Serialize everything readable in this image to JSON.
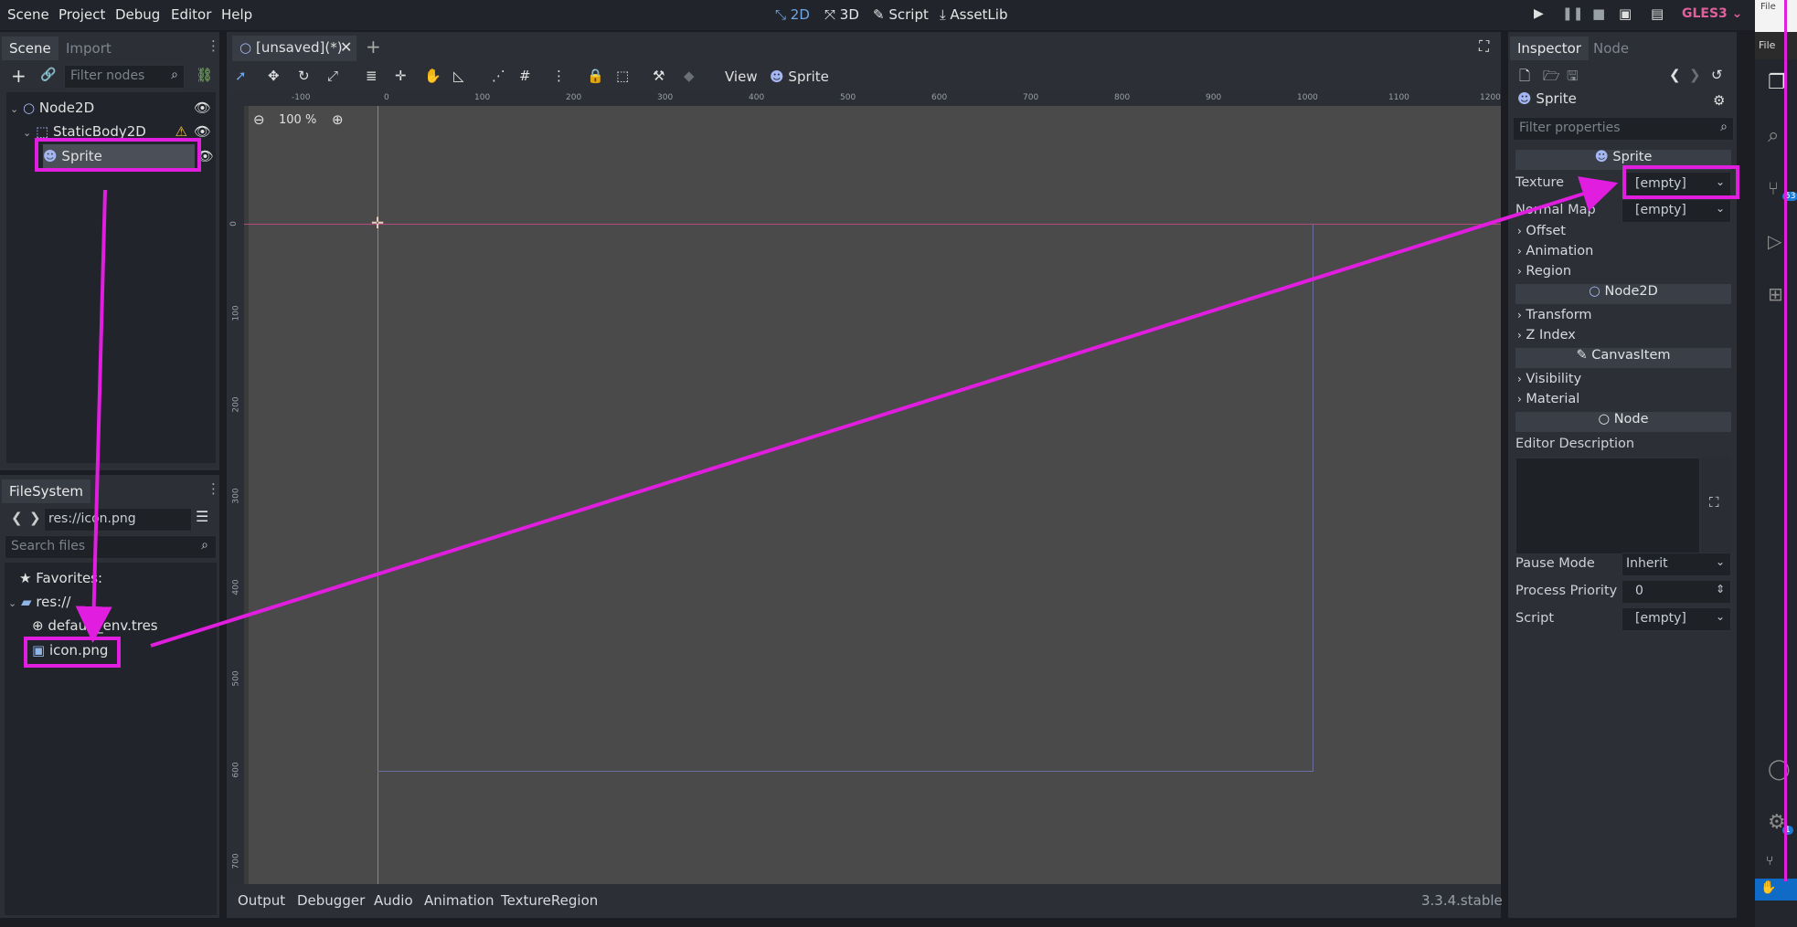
{
  "menubar": {
    "items": [
      "Scene",
      "Project",
      "Debug",
      "Editor",
      "Help"
    ],
    "modes": [
      {
        "icon": "2d-mode-icon",
        "label": "2D"
      },
      {
        "icon": "3d-mode-icon",
        "label": "3D"
      },
      {
        "icon": "script-icon",
        "label": "Script"
      },
      {
        "icon": "assetlib-icon",
        "label": "AssetLib"
      }
    ],
    "renderer": "GLES3"
  },
  "scene_dock": {
    "tabs": [
      "Scene",
      "Import"
    ],
    "filter_placeholder": "Filter nodes",
    "tree": [
      {
        "label": "Node2D",
        "icon": "node2d-icon"
      },
      {
        "label": "StaticBody2D",
        "icon": "staticbody-icon"
      },
      {
        "label": "Sprite",
        "icon": "sprite-icon"
      }
    ]
  },
  "filesystem_dock": {
    "tab": "FileSystem",
    "path": "res://icon.png",
    "search_placeholder": "Search files",
    "items": [
      {
        "label": "Favorites:",
        "icon": "star-icon"
      },
      {
        "label": "res://",
        "icon": "folder-icon"
      },
      {
        "label": "default_env.tres",
        "icon": "environment-icon"
      },
      {
        "label": "icon.png",
        "icon": "image-icon"
      }
    ]
  },
  "viewport": {
    "tab_title": "[unsaved](*)",
    "toolbar_view": "View",
    "toolbar_node": "Sprite",
    "zoom": "100 %",
    "hruler_ticks": [
      "-100",
      "0",
      "100",
      "200",
      "300",
      "400",
      "500",
      "600",
      "700",
      "800",
      "900",
      "1000",
      "1100",
      "1200"
    ],
    "vruler_ticks": [
      "0",
      "100",
      "200",
      "300",
      "400",
      "500",
      "600",
      "700"
    ]
  },
  "bottom_panel": {
    "tabs": [
      "Output",
      "Debugger",
      "Audio",
      "Animation",
      "TextureRegion"
    ],
    "version": "3.3.4.stable"
  },
  "inspector": {
    "tabs": [
      "Inspector",
      "Node"
    ],
    "object_name": "Sprite",
    "filter_placeholder": "Filter properties",
    "section_sprite": "Sprite",
    "texture_label": "Texture",
    "texture_value": "[empty]",
    "normal_map_label": "Normal Map",
    "normal_map_value": "[empty]",
    "groups_sprite": [
      "Offset",
      "Animation",
      "Region"
    ],
    "section_node2d": "Node2D",
    "groups_node2d": [
      "Transform",
      "Z Index"
    ],
    "section_canvasitem": "CanvasItem",
    "groups_canvasitem": [
      "Visibility",
      "Material"
    ],
    "section_node": "Node",
    "editor_description_label": "Editor Description",
    "pause_mode_label": "Pause Mode",
    "pause_mode_value": "Inherit",
    "process_priority_label": "Process Priority",
    "process_priority_value": "0",
    "script_label": "Script",
    "script_value": "[empty]"
  },
  "side_window": {
    "menu_file": "File",
    "badge_source_control": "53",
    "badge_settings": "1"
  },
  "colors": {
    "annotation": "#e11ee0",
    "accent": "#6fa6e6",
    "renderer": "#e0609e"
  }
}
